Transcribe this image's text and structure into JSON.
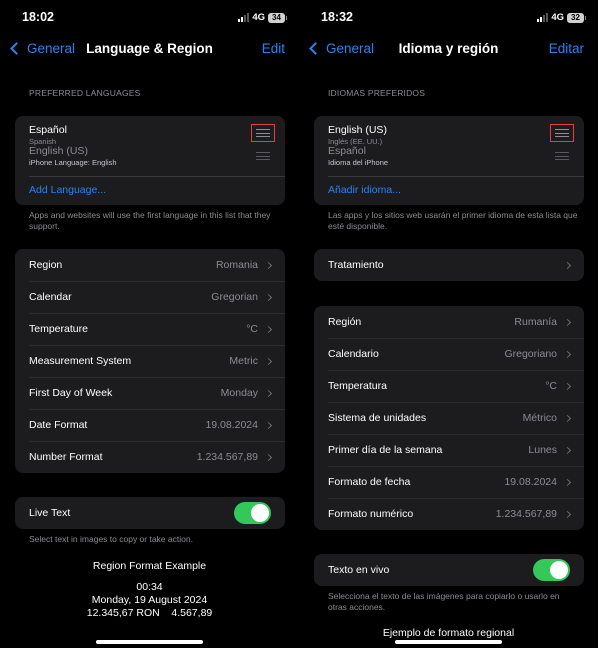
{
  "left": {
    "status": {
      "time": "18:02",
      "network": "4G",
      "battery": "34"
    },
    "nav": {
      "back_label": "General",
      "title": "Language & Region",
      "edit_label": "Edit"
    },
    "preferred_languages": {
      "header": "PREFERRED LANGUAGES",
      "items": [
        {
          "name": "Español",
          "subtitle": "Spanish"
        },
        {
          "name": "English (US)",
          "subtitle": "iPhone Language: English"
        }
      ],
      "add_label": "Add Language...",
      "footer": "Apps and websites will use the first language in this list that they support."
    },
    "region_settings": [
      {
        "label": "Region",
        "value": "Romania"
      },
      {
        "label": "Calendar",
        "value": "Gregorian"
      },
      {
        "label": "Temperature",
        "value": "°C"
      },
      {
        "label": "Measurement System",
        "value": "Metric"
      },
      {
        "label": "First Day of Week",
        "value": "Monday"
      },
      {
        "label": "Date Format",
        "value": "19.08.2024"
      },
      {
        "label": "Number Format",
        "value": "1.234.567,89"
      }
    ],
    "live_text": {
      "label": "Live Text",
      "enabled": true,
      "footer": "Select text in images to copy or take action."
    },
    "example": {
      "title": "Region Format Example",
      "time": "00:34",
      "date": "Monday, 19 August 2024",
      "currency": "12.345,67 RON",
      "number": "4.567,89"
    }
  },
  "right": {
    "status": {
      "time": "18:32",
      "network": "4G",
      "battery": "32"
    },
    "nav": {
      "back_label": "General",
      "title": "Idioma y región",
      "edit_label": "Editar"
    },
    "preferred_languages": {
      "header": "IDIOMAS PREFERIDOS",
      "items": [
        {
          "name": "English (US)",
          "subtitle": "Inglés (EE. UU.)"
        },
        {
          "name": "Español",
          "subtitle": "Idioma del iPhone"
        }
      ],
      "add_label": "Añadir idioma...",
      "footer": "Las apps y los sitios web usarán el primer idioma de esta lista que esté disponible."
    },
    "treatment": {
      "label": "Tratamiento"
    },
    "region_settings": [
      {
        "label": "Región",
        "value": "Rumanía"
      },
      {
        "label": "Calendario",
        "value": "Gregoriano"
      },
      {
        "label": "Temperatura",
        "value": "°C"
      },
      {
        "label": "Sistema de unidades",
        "value": "Métrico"
      },
      {
        "label": "Primer día de la semana",
        "value": "Lunes"
      },
      {
        "label": "Formato de fecha",
        "value": "19.08.2024"
      },
      {
        "label": "Formato numérico",
        "value": "1.234.567,89"
      }
    ],
    "live_text": {
      "label": "Texto en vivo",
      "enabled": true,
      "footer": "Selecciona el texto de las imágenes para copiarlo o usarlo en otras acciones."
    },
    "example": {
      "title": "Ejemplo de formato regional"
    }
  },
  "colors": {
    "accent": "#2a83f5",
    "toggle_on": "#34c759",
    "highlight_box": "#e04040",
    "cell_background": "#1c1c1e",
    "secondary_text": "#8d8d92"
  }
}
